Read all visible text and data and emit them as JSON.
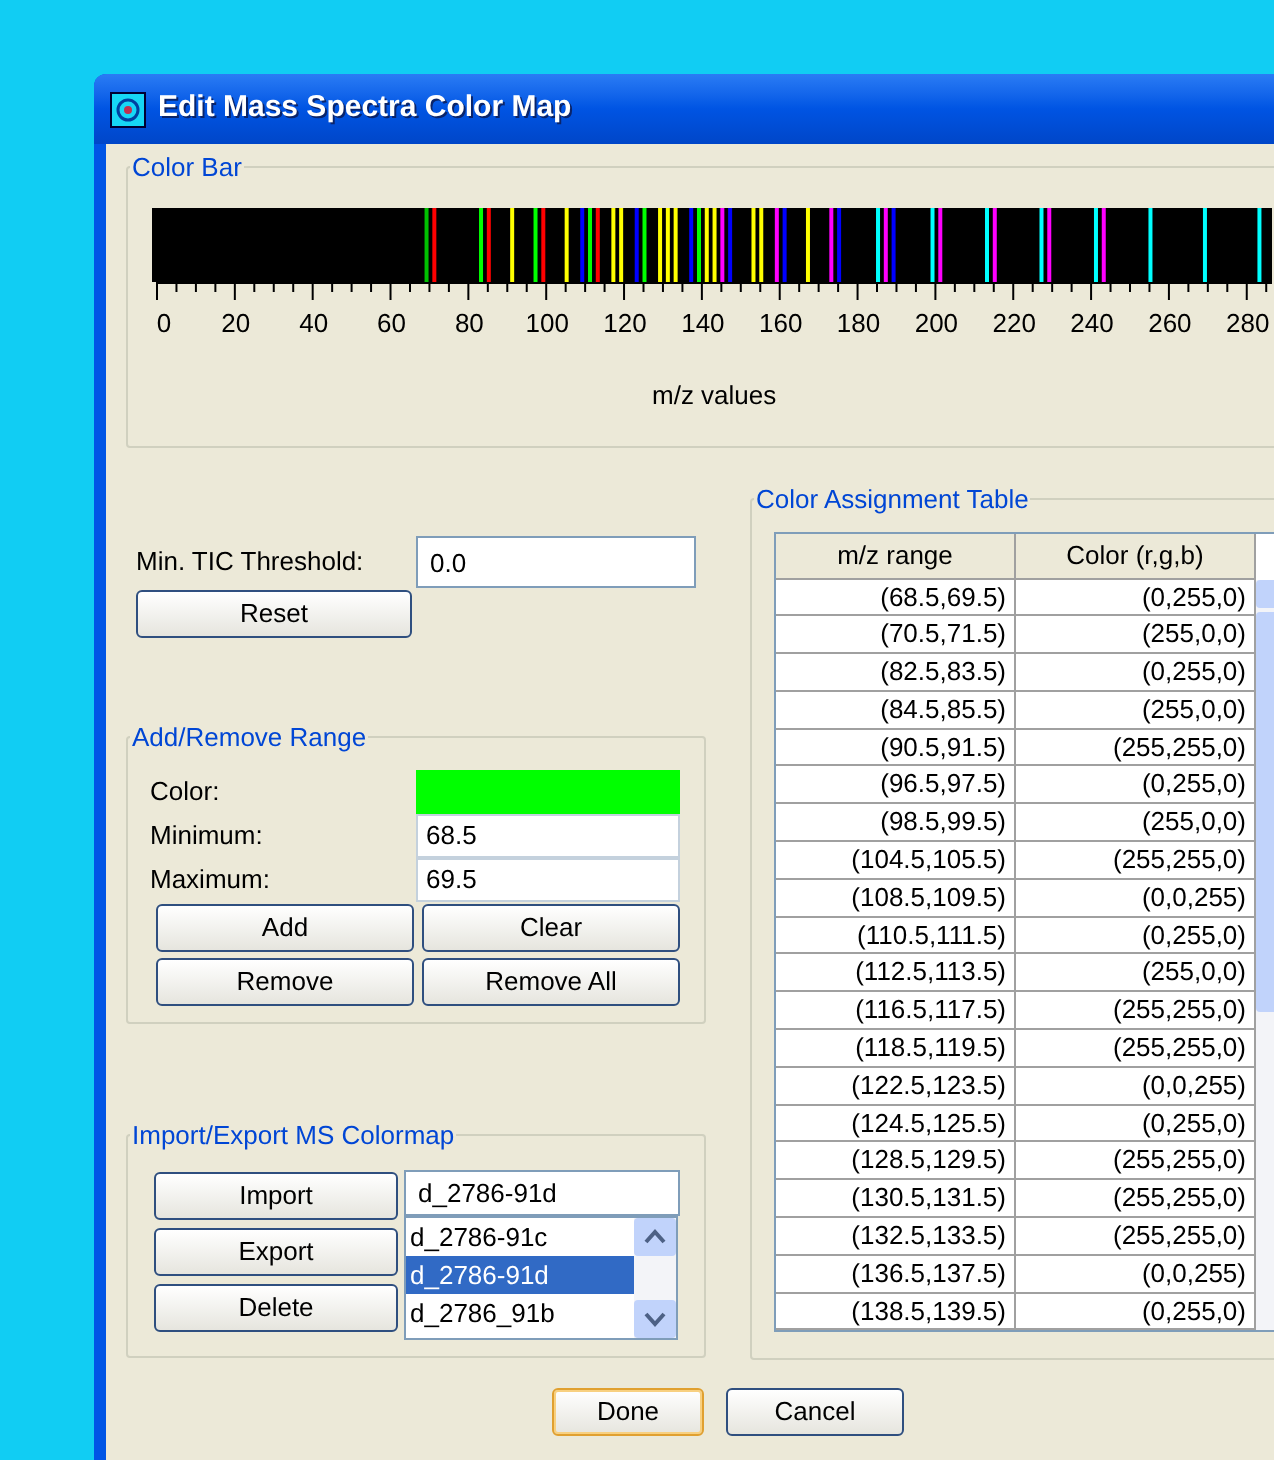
{
  "window": {
    "title": "Edit Mass Spectra Color Map"
  },
  "color_bar": {
    "title": "Color Bar",
    "axis_labels": [
      "0",
      "20",
      "40",
      "60",
      "80",
      "100",
      "120",
      "140",
      "160",
      "180",
      "200",
      "220",
      "240",
      "260",
      "280"
    ],
    "xlabel": "m/z values"
  },
  "threshold": {
    "label": "Min. TIC Threshold:",
    "value": "0.0",
    "reset_button": "Reset"
  },
  "add_remove": {
    "title": "Add/Remove Range",
    "color_label": "Color:",
    "color": "#00ff00",
    "minimum_label": "Minimum:",
    "minimum": "68.5",
    "maximum_label": "Maximum:",
    "maximum": "69.5",
    "buttons": [
      "Add",
      "Clear",
      "Remove",
      "Remove All"
    ]
  },
  "import_export": {
    "title": "Import/Export MS Colormap",
    "buttons": [
      "Import",
      "Export",
      "Delete"
    ],
    "name_value": "d_2786-91d",
    "list": [
      {
        "label": "d_2786-91c",
        "selected": false
      },
      {
        "label": "d_2786-91d",
        "selected": true
      },
      {
        "label": "d_2786_91b",
        "selected": false
      }
    ]
  },
  "table": {
    "title": "Color Assignment Table",
    "columns": [
      "m/z range",
      "Color (r,g,b)"
    ],
    "rows": [
      [
        "(68.5,69.5)",
        "(0,255,0)"
      ],
      [
        "(70.5,71.5)",
        "(255,0,0)"
      ],
      [
        "(82.5,83.5)",
        "(0,255,0)"
      ],
      [
        "(84.5,85.5)",
        "(255,0,0)"
      ],
      [
        "(90.5,91.5)",
        "(255,255,0)"
      ],
      [
        "(96.5,97.5)",
        "(0,255,0)"
      ],
      [
        "(98.5,99.5)",
        "(255,0,0)"
      ],
      [
        "(104.5,105.5)",
        "(255,255,0)"
      ],
      [
        "(108.5,109.5)",
        "(0,0,255)"
      ],
      [
        "(110.5,111.5)",
        "(0,255,0)"
      ],
      [
        "(112.5,113.5)",
        "(255,0,0)"
      ],
      [
        "(116.5,117.5)",
        "(255,255,0)"
      ],
      [
        "(118.5,119.5)",
        "(255,255,0)"
      ],
      [
        "(122.5,123.5)",
        "(0,0,255)"
      ],
      [
        "(124.5,125.5)",
        "(0,255,0)"
      ],
      [
        "(128.5,129.5)",
        "(255,255,0)"
      ],
      [
        "(130.5,131.5)",
        "(255,255,0)"
      ],
      [
        "(132.5,133.5)",
        "(255,255,0)"
      ],
      [
        "(136.5,137.5)",
        "(0,0,255)"
      ],
      [
        "(138.5,139.5)",
        "(0,255,0)"
      ]
    ]
  },
  "buttons": [
    "Done",
    "Cancel"
  ]
}
